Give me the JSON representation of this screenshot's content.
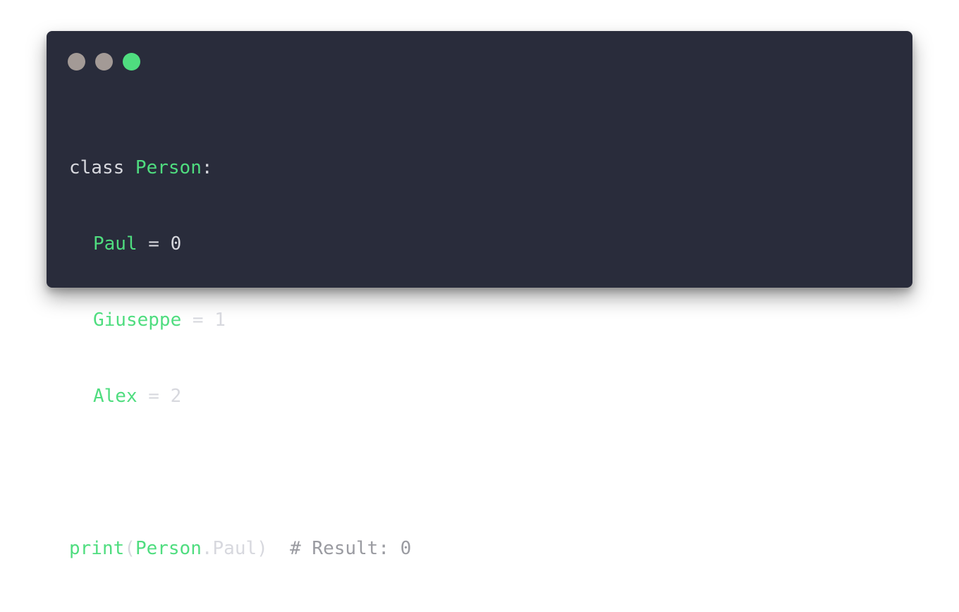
{
  "colors": {
    "background": "#292c3b",
    "text": "#d7d8de",
    "name": "#4fdd7f",
    "comment": "#9a9ba1",
    "dot_1": "#a39a96",
    "dot_2": "#a39a96",
    "dot_3": "#4fdd7f"
  },
  "window_controls": [
    {
      "name": "window-dot-1-icon"
    },
    {
      "name": "window-dot-2-icon"
    },
    {
      "name": "window-dot-3-icon"
    }
  ],
  "code": {
    "line1": {
      "keyword": "class ",
      "name": "Person",
      "punct": ":"
    },
    "line2": {
      "name": "Paul",
      "rest": " = 0"
    },
    "line3": {
      "name": "Giuseppe",
      "rest": " = 1"
    },
    "line4": {
      "name": "Alex",
      "rest": " = 2"
    },
    "line6": {
      "func": "print",
      "open": "(",
      "obj": "Person",
      "dot": ".",
      "attr": "Paul",
      "close": ")",
      "spacer": "  ",
      "comment": "# Result: 0"
    }
  }
}
